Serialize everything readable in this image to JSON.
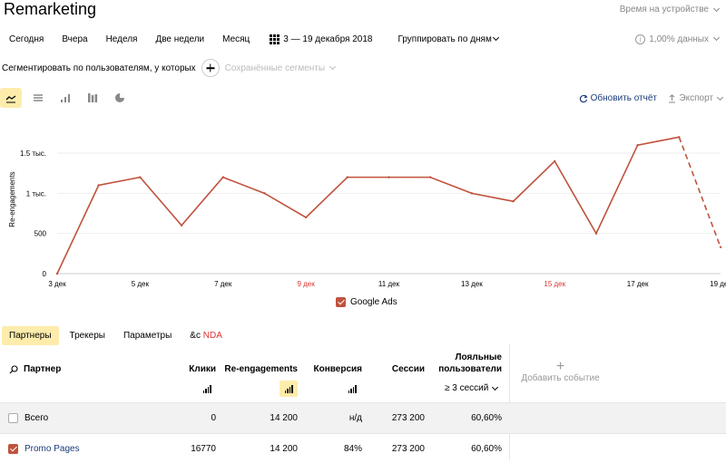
{
  "header": {
    "title": "Remarketing",
    "time_mode": "Время на устройстве"
  },
  "periods": [
    "Сегодня",
    "Вчера",
    "Неделя",
    "Две недели",
    "Месяц"
  ],
  "date_range": "3 — 19 декабря 2018",
  "grouping": "Группировать по дням",
  "sampling": "1,00% данных",
  "segment": {
    "label": "Сегментировать по пользователям, у которых",
    "saved_placeholder": "Сохранённые сегменты"
  },
  "chart_tools": [
    "line-chart-icon",
    "area-chart-icon",
    "bar-chart-icon",
    "stacked-bar-icon",
    "pie-chart-icon"
  ],
  "actions": {
    "refresh": "Обновить отчёт",
    "export": "Экспорт"
  },
  "chart_data": {
    "type": "line",
    "ylabel": "Re-engagements",
    "y_ticks": [
      "0",
      "500",
      "1 тыс.",
      "1.5 тыс."
    ],
    "y_tick_values": [
      0,
      500,
      1000,
      1500
    ],
    "ylim": [
      0,
      1850
    ],
    "x_tick_labels": [
      "3 дек",
      "5 дек",
      "7 дек",
      "9 дек",
      "11 дек",
      "13 дек",
      "15 дек",
      "17 дек",
      "19 дек"
    ],
    "x_tick_weekend": [
      false,
      false,
      false,
      true,
      false,
      false,
      true,
      false,
      false
    ],
    "x": [
      "3 дек",
      "4 дек",
      "5 дек",
      "6 дек",
      "7 дек",
      "8 дек",
      "9 дек",
      "10 дек",
      "11 дек",
      "12 дек",
      "13 дек",
      "14 дек",
      "15 дек",
      "16 дек",
      "17 дек",
      "18 дек",
      "19 дек"
    ],
    "series": [
      {
        "name": "Google Ads",
        "color": "#c0523d",
        "values": [
          0,
          1100,
          1200,
          600,
          1200,
          1000,
          700,
          1200,
          1200,
          1200,
          1000,
          900,
          1400,
          500,
          1600,
          1700,
          330
        ],
        "dashed_from_index": 15
      }
    ],
    "grid": true,
    "legend": "bottom"
  },
  "tabs": [
    {
      "label": "Партнеры",
      "active": true
    },
    {
      "label": "Трекеры",
      "active": false
    },
    {
      "label": "Параметры",
      "active": false
    },
    {
      "label": "&c",
      "badge": "NDA",
      "active": false
    }
  ],
  "table": {
    "headers": {
      "partner": "Партнер",
      "clicks": "Клики",
      "reengagements": "Re-engagements",
      "conversion": "Конверсия",
      "sessions": "Сессии",
      "loyal_line1": "Лояльные",
      "loyal_line2": "пользователи",
      "sessions_filter": "≥ 3 сессий",
      "add_event": "Добавить событие"
    },
    "rows": [
      {
        "partner": "Всего",
        "clicks": "0",
        "reengagements": "14 200",
        "conversion": "н/д",
        "sessions": "273 200",
        "loyal": "60,60%",
        "checked": false
      },
      {
        "partner": "Promo Pages",
        "clicks": "16770",
        "reengagements": "14 200",
        "conversion": "84%",
        "sessions": "273 200",
        "loyal": "60,60%",
        "checked": true
      }
    ]
  }
}
